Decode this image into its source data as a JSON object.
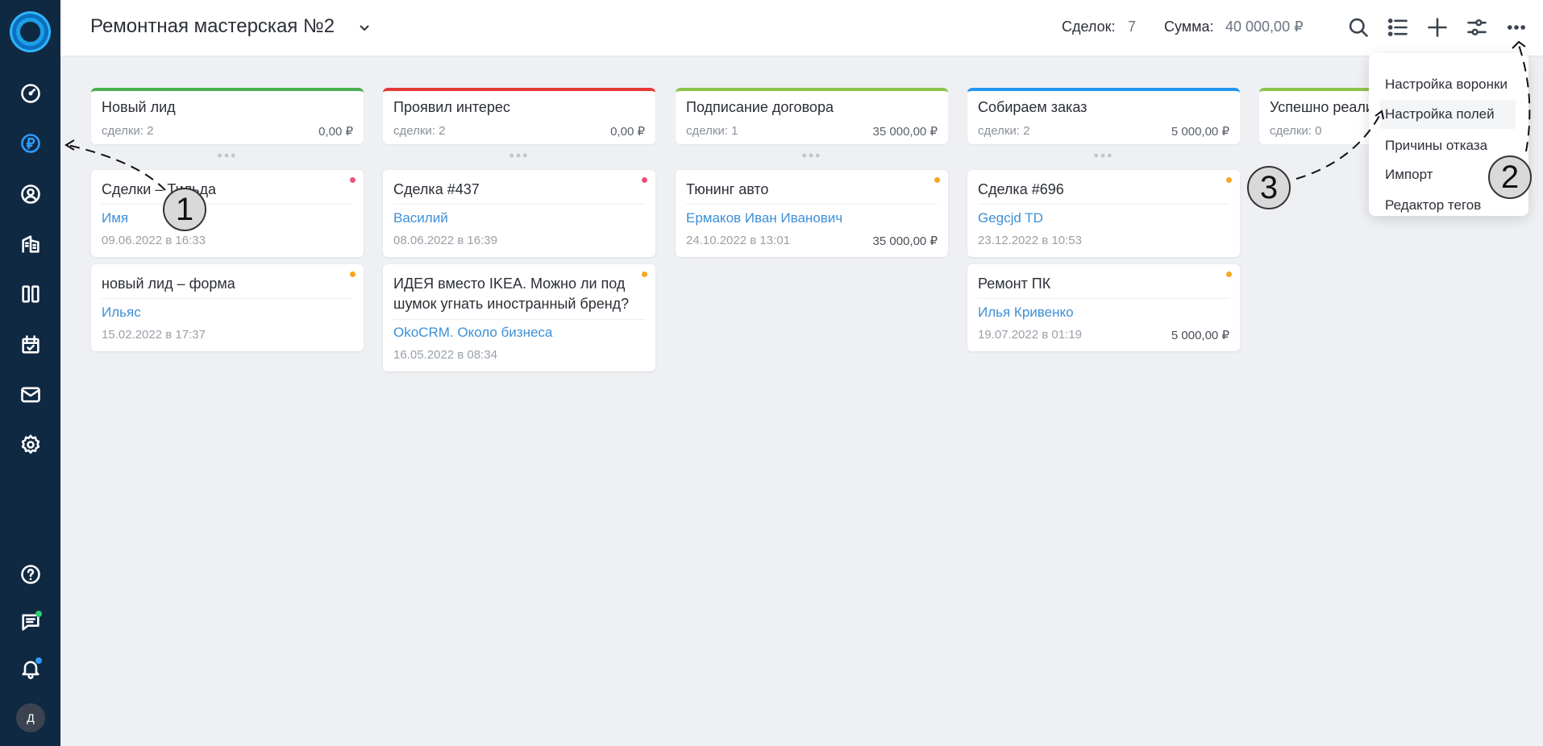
{
  "header": {
    "title": "Ремонтная мастерская №2",
    "deals_label": "Сделок:",
    "deals_value": "7",
    "sum_label": "Сумма:",
    "sum_value": "40 000,00 ₽"
  },
  "sidebar": {
    "avatar_initial": "Д"
  },
  "columns": [
    {
      "title": "Новый лид",
      "count": "сделки: 2",
      "sum": "0,00 ₽",
      "color": "#4caf50"
    },
    {
      "title": "Проявил интерес",
      "count": "сделки: 2",
      "sum": "0,00 ₽",
      "color": "#e53935"
    },
    {
      "title": "Подписание договора",
      "count": "сделки: 1",
      "sum": "35 000,00 ₽",
      "color": "#8bc34a"
    },
    {
      "title": "Собираем заказ",
      "count": "сделки: 2",
      "sum": "5 000,00 ₽",
      "color": "#2196f3"
    },
    {
      "title": "Успешно реализовано",
      "count": "сделки: 0",
      "sum": "",
      "color": "#8bc34a"
    }
  ],
  "cards": [
    {
      "title": "Сделки – Тильда",
      "contact": "Имя",
      "date": "09.06.2022 в 16:33",
      "sum": "",
      "dot": "#e8557a"
    },
    {
      "title": "новый лид – форма",
      "contact": "Ильяс",
      "date": "15.02.2022 в 17:37",
      "sum": "",
      "dot": "#f5a623"
    },
    {
      "title": "Сделка #437",
      "contact": "Василий",
      "date": "08.06.2022 в 16:39",
      "sum": "",
      "dot": "#e8557a"
    },
    {
      "title": "ИДЕЯ вместо IKEA. Можно ли под шумок угнать иностранный бренд?",
      "contact": "OkoCRM. Около бизнеса",
      "date": "16.05.2022 в 08:34",
      "sum": "",
      "dot": "#f5a623"
    },
    {
      "title": "Тюнинг авто",
      "contact": "Ермаков Иван Иванович",
      "date": "24.10.2022 в 13:01",
      "sum": "35 000,00 ₽",
      "dot": "#f5a623"
    },
    {
      "title": "Сделка #696",
      "contact": "Gegcjd TD",
      "date": "23.12.2022 в 10:53",
      "sum": "",
      "dot": "#f5a623"
    },
    {
      "title": "Ремонт ПК",
      "contact": "Илья Кривенко",
      "date": "19.07.2022 в 01:19",
      "sum": "5 000,00 ₽",
      "dot": "#f5a623"
    }
  ],
  "menu": {
    "items": [
      "Настройка воронки",
      "Настройка полей",
      "Причины отказа",
      "Импорт",
      "Редактор тегов"
    ]
  },
  "annotations": {
    "one": "1",
    "two": "2",
    "three": "3"
  },
  "icons": {
    "nav": [
      "dashboard-icon",
      "deals-ruble-icon",
      "contacts-icon",
      "companies-icon",
      "kanban-icon",
      "calendar-icon",
      "mail-icon",
      "settings-icon"
    ],
    "nav_bottom": [
      "help-icon",
      "chat-icon",
      "bell-icon"
    ],
    "header": [
      "search-icon",
      "list-view-icon",
      "add-icon",
      "filter-icon",
      "more-icon"
    ]
  },
  "colors": {
    "sidebar_bg": "#102942",
    "accent": "#2f9bff",
    "link": "#3d8fd8"
  }
}
